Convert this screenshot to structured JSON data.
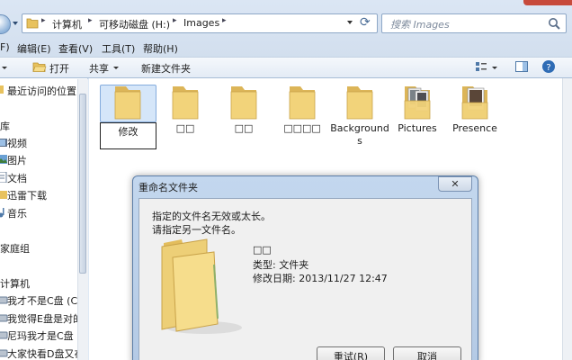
{
  "address": {
    "crumbs": [
      "计算机",
      "可移动磁盘 (H:)",
      "Images"
    ],
    "search_placeholder": "搜索 Images"
  },
  "menu": [
    "编辑(E)",
    "查看(V)",
    "工具(T)",
    "帮助(H)"
  ],
  "menu_partial": "F)",
  "toolbar": {
    "open": "打开",
    "share": "共享",
    "new_folder": "新建文件夹"
  },
  "nav": {
    "recent": "最近访问的位置",
    "library_partial": "库",
    "library_items": [
      "视频",
      "图片",
      "文档",
      "迅雷下载",
      "音乐"
    ],
    "homegroup_partial": "家庭组",
    "computer_partial": "计算机",
    "drives": [
      "我才不是C盘 (C:",
      "我觉得E盘是对的",
      "尼玛我才是C盘",
      "大家快看D盘又在"
    ]
  },
  "files": [
    {
      "label": "修改",
      "editing": true
    },
    {
      "label": "□□"
    },
    {
      "label": "□□"
    },
    {
      "label": "□□□□"
    },
    {
      "label": "Backgrounds"
    },
    {
      "label": "Pictures"
    },
    {
      "label": "Presence"
    }
  ],
  "dialog": {
    "title": "重命名文件夹",
    "close": "✕",
    "message_1": "指定的文件名无效或太长。",
    "message_2": "请指定另一文件名。",
    "file_name": "□□",
    "type_line": "类型: 文件夹",
    "date_line": "修改日期: 2013/11/27 12:47",
    "retry_button": "重试(R)",
    "cancel_button": "取消"
  },
  "colors": {
    "folder": "#f2d37a",
    "selection": "#d5e6f9",
    "accent": "#3a6ea5"
  }
}
